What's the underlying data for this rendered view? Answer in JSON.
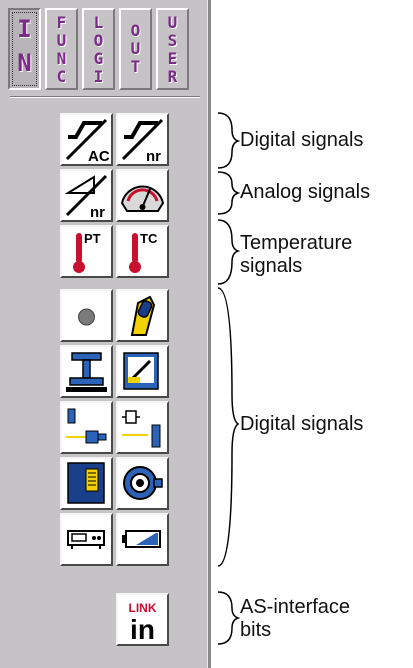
{
  "tabs": [
    {
      "id": "in",
      "letters": [
        "I",
        "N"
      ],
      "active": true
    },
    {
      "id": "func",
      "letters": [
        "F",
        "U",
        "N",
        "C"
      ],
      "active": false
    },
    {
      "id": "logi",
      "letters": [
        "L",
        "O",
        "G",
        "I"
      ],
      "active": false
    },
    {
      "id": "out",
      "letters": [
        "O",
        "U",
        "T"
      ],
      "active": false
    },
    {
      "id": "user",
      "letters": [
        "U",
        "S",
        "E",
        "R"
      ],
      "active": false
    }
  ],
  "buttons": {
    "digital_ac_label": "AC",
    "digital_nr_label": "nr",
    "analog_nr_label": "nr",
    "temp_pt_label": "PT",
    "temp_tc_label": "TC",
    "link_line1": "LINK",
    "link_line2": "in"
  },
  "annotations": {
    "digital_1": "Digital signals",
    "analog": "Analog signals",
    "temperature_line1": "Temperature",
    "temperature_line2": "signals",
    "digital_2": "Digital signals",
    "asi_line1": "AS-interface",
    "asi_line2": "bits"
  },
  "colors": {
    "panel": "#c6c3c6",
    "tab_text": "#7b2a88",
    "icon_blue": "#2b63b8",
    "icon_red": "#c8102e",
    "icon_yellow": "#f2d200"
  }
}
